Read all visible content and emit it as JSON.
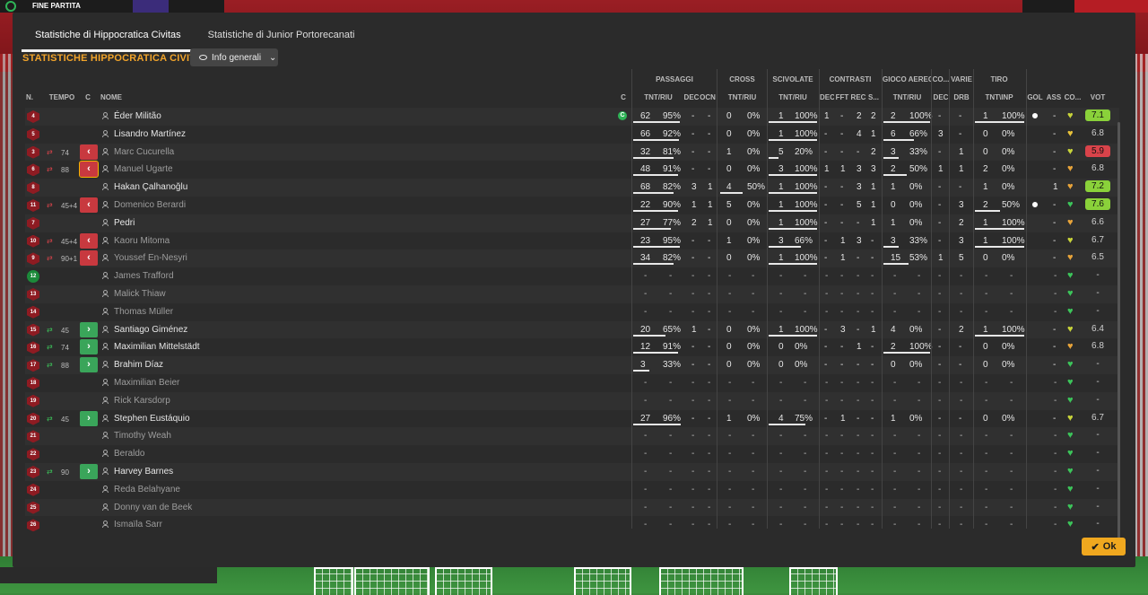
{
  "topbar": {
    "status": "FINE PARTITA"
  },
  "tabs": [
    {
      "label": "Statistiche di Hippocratica Civitas",
      "active": true
    },
    {
      "label": "Statistiche di Junior Portorecanati",
      "active": false
    }
  ],
  "section_title": "STATISTICHE HIPPOCRATICA CIVITAS",
  "dropdown": {
    "label": "Info generali",
    "icon": "eye-icon"
  },
  "headers_top": [
    "PASSAGGI",
    "CROSS",
    "SCIVOLATE",
    "CONTRASTI",
    "GIOCO AEREO",
    "CO...",
    "VARIE",
    "TIRO"
  ],
  "headers": {
    "n": "N.",
    "tempo": "TEMPO",
    "c": "C",
    "nome": "NOME",
    "cap": "C",
    "pass_tnt": "TNT/RIU",
    "pass_dec": "DEC",
    "pass_ocn": "OCN",
    "cross_tnt": "TNT/RIU",
    "sciv_tnt": "TNT/RIU",
    "con_dec": "DEC",
    "con_fft": "FFT",
    "con_rec": "REC",
    "con_s": "S...",
    "aer_tnt": "TNT/RIU",
    "co_dec": "DEC",
    "drb": "DRB",
    "tiro": "TNT\\INP",
    "gol": "GOL",
    "ass": "ASS",
    "cond": "CO...",
    "vot": "VOT"
  },
  "players": [
    {
      "n": "4",
      "time": "",
      "sub": "",
      "name": "Éder Militão",
      "cap": true,
      "p": [
        "62",
        "95%"
      ],
      "pd": "-",
      "po": "-",
      "cr": [
        "0",
        "0%"
      ],
      "sc": [
        "1",
        "100%"
      ],
      "ct": [
        "1",
        "-",
        "2",
        "2"
      ],
      "ae": [
        "2",
        "100%"
      ],
      "cd": "-",
      "drb": "-",
      "ti": [
        "1",
        "100%"
      ],
      "gol": "ball",
      "ass": "-",
      "heart": "#c8d43a",
      "vot": "7.1",
      "votc": "#8ad13a",
      "pbar": 0.95,
      "sbar": 1.0,
      "abar": 1.0,
      "tbar": 1.0
    },
    {
      "n": "5",
      "time": "",
      "sub": "",
      "name": "Lisandro Martínez",
      "p": [
        "66",
        "92%"
      ],
      "pd": "-",
      "po": "-",
      "cr": [
        "0",
        "0%"
      ],
      "sc": [
        "1",
        "100%"
      ],
      "ct": [
        "-",
        "-",
        "4",
        "1"
      ],
      "ae": [
        "6",
        "66%"
      ],
      "cd": "3",
      "drb": "-",
      "ti": [
        "0",
        "0%"
      ],
      "gol": "",
      "ass": "-",
      "heart": "#e8c23a",
      "vot": "6.8",
      "pbar": 0.92,
      "sbar": 1.0,
      "abar": 0.66
    },
    {
      "n": "3",
      "time": "74",
      "sub": "out",
      "name": "Marc Cucurella",
      "dim": true,
      "p": [
        "32",
        "81%"
      ],
      "pd": "-",
      "po": "-",
      "cr": [
        "1",
        "0%"
      ],
      "sc": [
        "5",
        "20%"
      ],
      "ct": [
        "-",
        "-",
        "-",
        "2"
      ],
      "ae": [
        "3",
        "33%"
      ],
      "cd": "-",
      "drb": "1",
      "ti": [
        "0",
        "0%"
      ],
      "gol": "",
      "ass": "-",
      "heart": "#c8d43a",
      "vot": "5.9",
      "votc": "#d9434a",
      "pbar": 0.81,
      "sbar": 0.2,
      "abar": 0.33
    },
    {
      "n": "6",
      "time": "88",
      "sub": "out",
      "selected": true,
      "name": "Manuel Ugarte",
      "dim": true,
      "p": [
        "48",
        "91%"
      ],
      "pd": "-",
      "po": "-",
      "cr": [
        "0",
        "0%"
      ],
      "sc": [
        "3",
        "100%"
      ],
      "ct": [
        "1",
        "1",
        "3",
        "3"
      ],
      "ae": [
        "2",
        "50%"
      ],
      "cd": "1",
      "drb": "1",
      "ti": [
        "2",
        "0%"
      ],
      "gol": "",
      "ass": "-",
      "heart": "#e8a43a",
      "vot": "6.8",
      "pbar": 0.91,
      "sbar": 1.0,
      "abar": 0.5
    },
    {
      "n": "8",
      "time": "",
      "sub": "",
      "name": "Hakan Çalhanoğlu",
      "p": [
        "68",
        "82%"
      ],
      "pd": "3",
      "po": "1",
      "cr": [
        "4",
        "50%"
      ],
      "sc": [
        "1",
        "100%"
      ],
      "ct": [
        "-",
        "-",
        "3",
        "1"
      ],
      "ae": [
        "1",
        "0%"
      ],
      "cd": "-",
      "drb": "-",
      "ti": [
        "1",
        "0%"
      ],
      "gol": "",
      "ass": "1",
      "heart": "#e8a43a",
      "vot": "7.2",
      "votc": "#8ad13a",
      "pbar": 0.82,
      "cbar": 0.5,
      "sbar": 1.0
    },
    {
      "n": "11",
      "time": "45+4",
      "sub": "out",
      "name": "Domenico Berardi",
      "dim": true,
      "p": [
        "22",
        "90%"
      ],
      "pd": "1",
      "po": "1",
      "cr": [
        "5",
        "0%"
      ],
      "sc": [
        "1",
        "100%"
      ],
      "ct": [
        "-",
        "-",
        "5",
        "1"
      ],
      "ae": [
        "0",
        "0%"
      ],
      "cd": "-",
      "drb": "3",
      "ti": [
        "2",
        "50%"
      ],
      "gol": "ball",
      "ass": "-",
      "heart": "#3cc45a",
      "vot": "7.6",
      "votc": "#8ad13a",
      "pbar": 0.9,
      "sbar": 1.0,
      "tbar": 0.5
    },
    {
      "n": "7",
      "time": "",
      "sub": "",
      "name": "Pedri",
      "p": [
        "27",
        "77%"
      ],
      "pd": "2",
      "po": "1",
      "cr": [
        "0",
        "0%"
      ],
      "sc": [
        "1",
        "100%"
      ],
      "ct": [
        "-",
        "-",
        "-",
        "1"
      ],
      "ae": [
        "1",
        "0%"
      ],
      "cd": "-",
      "drb": "2",
      "ti": [
        "1",
        "100%"
      ],
      "gol": "",
      "ass": "-",
      "heart": "#e8a43a",
      "vot": "6.6",
      "pbar": 0.77,
      "sbar": 1.0,
      "tbar": 1.0
    },
    {
      "n": "10",
      "time": "45+4",
      "sub": "out",
      "name": "Kaoru Mitoma",
      "dim": true,
      "p": [
        "23",
        "95%"
      ],
      "pd": "-",
      "po": "-",
      "cr": [
        "1",
        "0%"
      ],
      "sc": [
        "3",
        "66%"
      ],
      "ct": [
        "-",
        "1",
        "3",
        "-"
      ],
      "ae": [
        "3",
        "33%"
      ],
      "cd": "-",
      "drb": "3",
      "ti": [
        "1",
        "100%"
      ],
      "gol": "",
      "ass": "-",
      "heart": "#c8d43a",
      "vot": "6.7",
      "pbar": 0.95,
      "sbar": 0.66,
      "abar": 0.33,
      "tbar": 1.0
    },
    {
      "n": "9",
      "time": "90+1",
      "sub": "out",
      "name": "Youssef En-Nesyri",
      "dim": true,
      "p": [
        "34",
        "82%"
      ],
      "pd": "-",
      "po": "-",
      "cr": [
        "0",
        "0%"
      ],
      "sc": [
        "1",
        "100%"
      ],
      "ct": [
        "-",
        "1",
        "-",
        "-"
      ],
      "ae": [
        "15",
        "53%"
      ],
      "cd": "1",
      "drb": "5",
      "ti": [
        "0",
        "0%"
      ],
      "gol": "",
      "ass": "-",
      "heart": "#e8a43a",
      "vot": "6.5",
      "pbar": 0.82,
      "sbar": 1.0,
      "abar": 0.53
    },
    {
      "n": "12",
      "gk": true,
      "time": "",
      "sub": "",
      "name": "James Trafford",
      "dim": true,
      "empty": true,
      "heart": "#3cc45a",
      "vot": "-"
    },
    {
      "n": "13",
      "time": "",
      "sub": "",
      "name": "Malick Thiaw",
      "dim": true,
      "empty": true,
      "heart": "#3cc45a",
      "vot": "-"
    },
    {
      "n": "14",
      "time": "",
      "sub": "",
      "name": "Thomas Müller",
      "dim": true,
      "empty": true,
      "heart": "#3cc45a",
      "vot": "-"
    },
    {
      "n": "15",
      "time": "45",
      "sub": "in",
      "name": "Santiago Giménez",
      "p": [
        "20",
        "65%"
      ],
      "pd": "1",
      "po": "-",
      "cr": [
        "0",
        "0%"
      ],
      "sc": [
        "1",
        "100%"
      ],
      "ct": [
        "-",
        "3",
        "-",
        "1"
      ],
      "ae": [
        "4",
        "0%"
      ],
      "cd": "-",
      "drb": "2",
      "ti": [
        "1",
        "100%"
      ],
      "gol": "",
      "ass": "-",
      "heart": "#c8d43a",
      "vot": "6.4",
      "pbar": 0.65,
      "sbar": 1.0,
      "tbar": 1.0
    },
    {
      "n": "16",
      "time": "74",
      "sub": "in",
      "name": "Maximilian Mittelstädt",
      "p": [
        "12",
        "91%"
      ],
      "pd": "-",
      "po": "-",
      "cr": [
        "0",
        "0%"
      ],
      "sc": [
        "0",
        "0%"
      ],
      "ct": [
        "-",
        "-",
        "1",
        "-"
      ],
      "ae": [
        "2",
        "100%"
      ],
      "cd": "-",
      "drb": "-",
      "ti": [
        "0",
        "0%"
      ],
      "gol": "",
      "ass": "-",
      "heart": "#e8a43a",
      "vot": "6.8",
      "pbar": 0.91,
      "abar": 1.0
    },
    {
      "n": "17",
      "time": "88",
      "sub": "in",
      "name": "Brahim Díaz",
      "p": [
        "3",
        "33%"
      ],
      "pd": "-",
      "po": "-",
      "cr": [
        "0",
        "0%"
      ],
      "sc": [
        "0",
        "0%"
      ],
      "ct": [
        "-",
        "-",
        "-",
        "-"
      ],
      "ae": [
        "0",
        "0%"
      ],
      "cd": "-",
      "drb": "-",
      "ti": [
        "0",
        "0%"
      ],
      "gol": "",
      "ass": "-",
      "heart": "#3cc45a",
      "vot": "-",
      "pbar": 0.33
    },
    {
      "n": "18",
      "time": "",
      "sub": "",
      "name": "Maximilian Beier",
      "dim": true,
      "empty": true,
      "heart": "#3cc45a",
      "vot": "-"
    },
    {
      "n": "19",
      "time": "",
      "sub": "",
      "name": "Rick Karsdorp",
      "dim": true,
      "empty": true,
      "heart": "#3cc45a",
      "vot": "-"
    },
    {
      "n": "20",
      "time": "45",
      "sub": "in",
      "name": "Stephen Eustáquio",
      "p": [
        "27",
        "96%"
      ],
      "pd": "-",
      "po": "-",
      "cr": [
        "1",
        "0%"
      ],
      "sc": [
        "4",
        "75%"
      ],
      "ct": [
        "-",
        "1",
        "-",
        "-"
      ],
      "ae": [
        "1",
        "0%"
      ],
      "cd": "-",
      "drb": "-",
      "ti": [
        "0",
        "0%"
      ],
      "gol": "",
      "ass": "-",
      "heart": "#c8d43a",
      "vot": "6.7",
      "pbar": 0.96,
      "sbar": 0.75
    },
    {
      "n": "21",
      "time": "",
      "sub": "",
      "name": "Timothy Weah",
      "dim": true,
      "empty": true,
      "heart": "#3cc45a",
      "vot": "-"
    },
    {
      "n": "22",
      "time": "",
      "sub": "",
      "name": "Beraldo",
      "dim": true,
      "empty": true,
      "heart": "#3cc45a",
      "vot": "-"
    },
    {
      "n": "23",
      "time": "90",
      "sub": "in",
      "name": "Harvey Barnes",
      "empty": true,
      "heart": "#3cc45a",
      "vot": "-"
    },
    {
      "n": "24",
      "time": "",
      "sub": "",
      "name": "Reda Belahyane",
      "dim": true,
      "empty": true,
      "heart": "#3cc45a",
      "vot": "-"
    },
    {
      "n": "25",
      "time": "",
      "sub": "",
      "name": "Donny van de Beek",
      "dim": true,
      "empty": true,
      "heart": "#3cc45a",
      "vot": "-"
    },
    {
      "n": "26",
      "time": "",
      "sub": "",
      "name": "Ismaïla Sarr",
      "dim": true,
      "empty": true,
      "heart": "#3cc45a",
      "vot": "-"
    }
  ],
  "ok_button": "Ok"
}
